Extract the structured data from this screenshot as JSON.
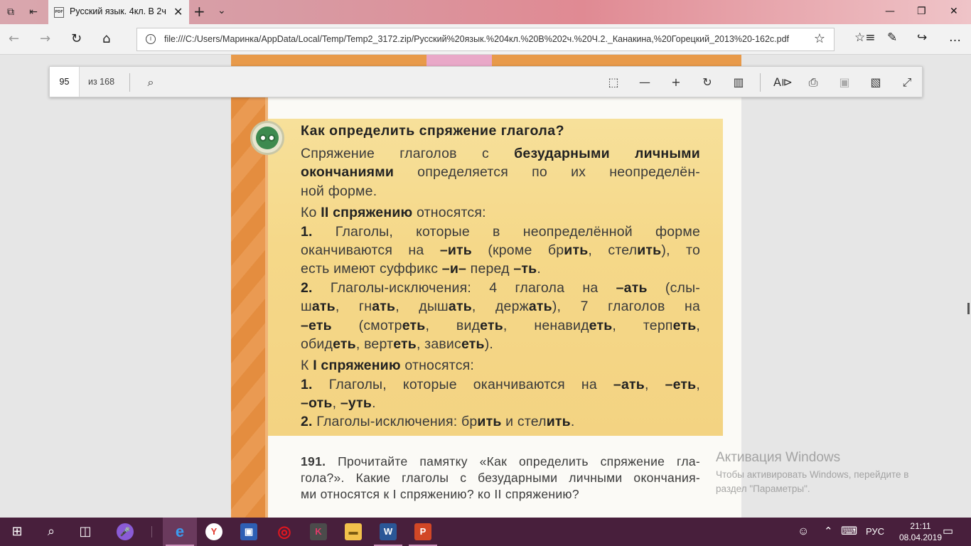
{
  "browser": {
    "tab_title": "Русский язык. 4кл. В 2ч",
    "pdf_badge": "PDF",
    "url": "file:///C:/Users/Маринка/AppData/Local/Temp/Temp2_3172.zip/Русский%20язык.%204кл.%20В%202ч.%20Ч.2._Канакина,%20Горецкий_2013%20-162с.pdf"
  },
  "pdf_toolbar": {
    "current_page": "95",
    "page_total_label": "из 168"
  },
  "page": {
    "heading": "Как определить спряжение глагола?",
    "lines": [
      [
        "Спряжение глаголов с ",
        "безударными личными"
      ],
      [
        "окончаниями",
        " определяется по их неопределён-"
      ],
      [
        "ной форме."
      ],
      [
        "Ко ",
        "II спряжению",
        " относятся:"
      ],
      [
        "1.",
        " Глаголы, которые в неопределённой форме"
      ],
      [
        "оканчиваются на ",
        "–ить",
        " (кроме бр",
        "ить",
        ", стел",
        "ить",
        "), то"
      ],
      [
        "есть имеют суффикс ",
        "–и–",
        " перед ",
        "–ть",
        "."
      ],
      [
        "2.",
        " Глаголы-исключения: 4 глагола на ",
        "–ать",
        " (слы-"
      ],
      [
        "ш",
        "ать",
        ", гн",
        "ать",
        ", дыш",
        "ать",
        ", держ",
        "ать",
        "), 7 глаголов на"
      ],
      [
        "–еть",
        " (смотр",
        "еть",
        ", вид",
        "еть",
        ", ненавид",
        "еть",
        ", терп",
        "еть",
        ","
      ],
      [
        "обид",
        "еть",
        ", верт",
        "еть",
        ", завис",
        "еть",
        ")."
      ],
      [
        "К ",
        "I спряжению",
        " относятся:"
      ],
      [
        "1.",
        " Глаголы, которые оканчиваются на ",
        "–ать",
        ", ",
        "–еть",
        ","
      ],
      [
        "–оть",
        ", ",
        "–уть",
        "."
      ],
      [
        "2.",
        " Глаголы-исключения: бр",
        "ить",
        " и стел",
        "ить",
        "."
      ]
    ],
    "exercise": [
      [
        "191.",
        " Прочитайте памятку «Как определить спряжение гла-"
      ],
      [
        "гола?». Какие глаголы с безударными личными окончания-"
      ],
      [
        "ми относятся к I спряжению? ко II спряжению?"
      ]
    ]
  },
  "watermark": {
    "title": "Активация Windows",
    "line1": "Чтобы активировать Windows, перейдите в",
    "line2": "раздел \"Параметры\"."
  },
  "taskbar": {
    "lang": "РУС",
    "time": "21:11",
    "date": "08.04.2019",
    "colors": {
      "bg": "#481f3c",
      "edge": "#1e73d6",
      "yandex": "#e23a2e",
      "opera": "#e0161f",
      "word": "#2b5797",
      "powerpoint": "#d24726",
      "explorer": "#f2c14b"
    }
  }
}
